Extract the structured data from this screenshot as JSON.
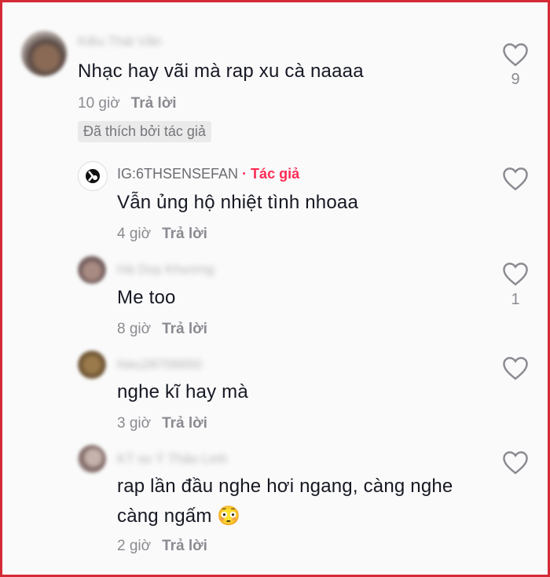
{
  "comments": [
    {
      "username": "Kiều Thái Văn",
      "text": "Nhạc hay vãi mà rap xu cà naaaa",
      "time": "10 giờ",
      "reply_label": "Trả lời",
      "likes": "9",
      "badge": "Đã thích bởi tác giả"
    },
    {
      "username": "IG:6THSENSEFAN",
      "author_label": "· Tác giả",
      "text": "Vẫn ủng hộ nhiệt tình nhoaa",
      "time": "4 giờ",
      "reply_label": "Trả lời"
    },
    {
      "username": "Hà Duy Khương",
      "text": "Me too",
      "time": "8 giờ",
      "reply_label": "Trả lời",
      "likes": "1"
    },
    {
      "username": "hieu28706650",
      "text": "nghe kĩ hay mà",
      "time": "3 giờ",
      "reply_label": "Trả lời"
    },
    {
      "username": "KT so Ý Thảo Linh",
      "text_line1": "rap lần đầu nghe hơi ngang, càng nghe",
      "text_line2": "càng ngấm 😳",
      "time": "2 giờ",
      "reply_label": "Trả lời"
    }
  ],
  "colors": {
    "frame": "#d42a35",
    "author": "#fe2c55"
  }
}
